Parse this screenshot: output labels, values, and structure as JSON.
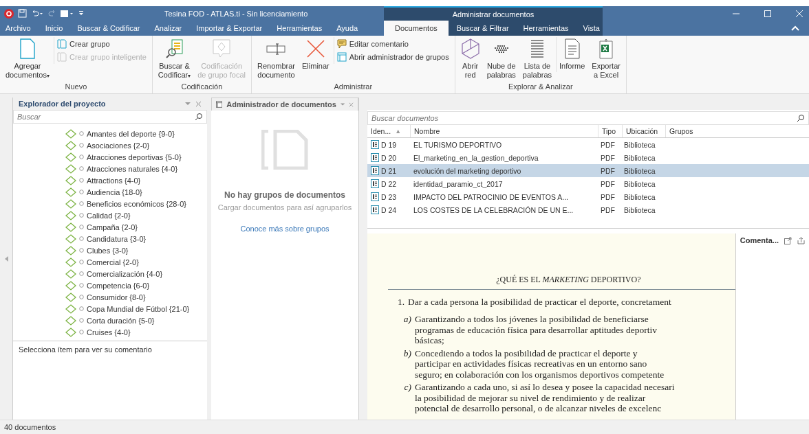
{
  "window": {
    "title": "Tesina FOD - ATLAS.ti - Sin licenciamiento"
  },
  "menu_tabs": [
    {
      "label": "Archivo",
      "selected": false
    },
    {
      "label": "Inicio",
      "selected": false
    },
    {
      "label": "Buscar & Codificar",
      "selected": false
    },
    {
      "label": "Analizar",
      "selected": false
    },
    {
      "label": "Importar & Exportar",
      "selected": false
    },
    {
      "label": "Herramientas",
      "selected": false
    },
    {
      "label": "Ayuda",
      "selected": false
    }
  ],
  "contextual_group": {
    "title": "Administrar documentos",
    "tabs": [
      {
        "label": "Documentos",
        "selected": true
      },
      {
        "label": "Buscar & Filtrar",
        "selected": false
      },
      {
        "label": "Herramientas",
        "selected": false
      },
      {
        "label": "Vista",
        "selected": false
      }
    ]
  },
  "ribbon": {
    "groups": [
      {
        "label": "Nuevo",
        "buttons": [
          {
            "label": "Agregar\ndocumentos",
            "caret": "▾",
            "disabled": false
          },
          {
            "label": "Crear grupo",
            "disabled": false
          },
          {
            "label": "Crear grupo inteligente",
            "disabled": true
          }
        ]
      },
      {
        "label": "Codificación",
        "buttons": [
          {
            "label": "Buscar &\nCodificar",
            "caret": "▾",
            "disabled": false
          },
          {
            "label": "Codificación\nde grupo focal",
            "disabled": true
          }
        ]
      },
      {
        "label": "Administrar",
        "buttons": [
          {
            "label": "Renombrar\ndocumento",
            "disabled": false
          },
          {
            "label": "Eliminar",
            "disabled": false
          },
          {
            "label": "Editar comentario",
            "disabled": false
          },
          {
            "label": "Abrir administrador de grupos",
            "disabled": false
          }
        ]
      },
      {
        "label": "Explorar & Analizar",
        "buttons": [
          {
            "label": "Abrir\nred",
            "disabled": false
          },
          {
            "label": "Nube de\npalabras",
            "disabled": false
          },
          {
            "label": "Lista de\npalabras",
            "disabled": false
          },
          {
            "label": "Informe",
            "disabled": false
          },
          {
            "label": "Exportar\na Excel",
            "disabled": false
          }
        ]
      }
    ]
  },
  "project_explorer": {
    "title": "Explorador del proyecto",
    "search": {
      "placeholder": "Buscar"
    },
    "codes": [
      {
        "label": "Amantes del deporte {9-0}"
      },
      {
        "label": "Asociaciones {2-0}"
      },
      {
        "label": "Atracciones deportivas {5-0}"
      },
      {
        "label": "Atracciones naturales {4-0}"
      },
      {
        "label": "Attractions {4-0}"
      },
      {
        "label": "Audiencia {18-0}"
      },
      {
        "label": "Beneficios económicos {28-0}"
      },
      {
        "label": "Calidad {2-0}"
      },
      {
        "label": "Campaña {2-0}"
      },
      {
        "label": "Candidatura {3-0}"
      },
      {
        "label": "Clubes {3-0}"
      },
      {
        "label": "Comercial {2-0}"
      },
      {
        "label": "Comercialización {4-0}"
      },
      {
        "label": "Competencia {6-0}"
      },
      {
        "label": "Consumidor {8-0}"
      },
      {
        "label": "Copa Mundial de Fútbol {21-0}"
      },
      {
        "label": "Corta duración {5-0}"
      },
      {
        "label": "Cruises {4-0}"
      }
    ],
    "comment_hint": "Selecciona ítem para ver su comentario"
  },
  "document_manager": {
    "tab": "Administrador de documentos",
    "groups_empty": {
      "title": "No hay grupos de documentos",
      "subtitle": "Cargar documentos para así agruparlos",
      "link": "Conoce más sobre grupos"
    },
    "search": {
      "placeholder": "Buscar documentos"
    },
    "columns": [
      {
        "label": "Iden...",
        "sort": "▲"
      },
      {
        "label": "Nombre"
      },
      {
        "label": "Tipo"
      },
      {
        "label": "Ubicación"
      },
      {
        "label": "Grupos"
      }
    ],
    "rows": [
      {
        "id": "D 19",
        "name": "EL TURISMO DEPORTIVO",
        "type": "PDF",
        "location": "Biblioteca",
        "selected": false
      },
      {
        "id": "D 20",
        "name": "El_marketing_en_la_gestion_deportiva",
        "type": "PDF",
        "location": "Biblioteca",
        "selected": false
      },
      {
        "id": "D 21",
        "name": "evolución del marketing deportivo",
        "type": "PDF",
        "location": "Biblioteca",
        "selected": true
      },
      {
        "id": "D 22",
        "name": "identidad_paramio_ct_2017",
        "type": "PDF",
        "location": "Biblioteca",
        "selected": false
      },
      {
        "id": "D 23",
        "name": "IMPACTO DEL PATROCINIO DE EVENTOS A...",
        "type": "PDF",
        "location": "Biblioteca",
        "selected": false
      },
      {
        "id": "D 24",
        "name": "LOS COSTES DE LA CELEBRACIÓN DE UN E...",
        "type": "PDF",
        "location": "Biblioteca",
        "selected": false
      }
    ],
    "preview": {
      "heading": "¿QUÉ ES EL *MARKETING* DEPORTIVO?",
      "items": [
        {
          "marker": "1.",
          "lines": [
            "Dar a cada persona la posibilidad de practicar el deporte, concretament"
          ],
          "children": [
            {
              "marker": "a)",
              "lines": [
                "Garantizando a todos los jóvenes la posibilidad de beneficiarse",
                "programas de educación física para desarrollar aptitudes deportiv",
                "básicas;"
              ]
            },
            {
              "marker": "b)",
              "lines": [
                "Concediendo a todos la posibilidad de practicar el deporte y",
                "participar en actividades físicas recreativas en un entorno sano",
                "seguro; en colaboración con los organismos deportivos competente"
              ]
            },
            {
              "marker": "c)",
              "lines": [
                "Garantizando a cada uno, si así lo desea y posee la capacidad necesari",
                "la posibilidad de mejorar su nivel de rendimiento y de realizar",
                "potencial de desarrollo personal, o de alcanzar niveles de excelenc"
              ]
            }
          ]
        }
      ]
    },
    "comment_pane": {
      "title": "Comenta..."
    }
  },
  "status_bar": {
    "text": "40 documentos"
  }
}
